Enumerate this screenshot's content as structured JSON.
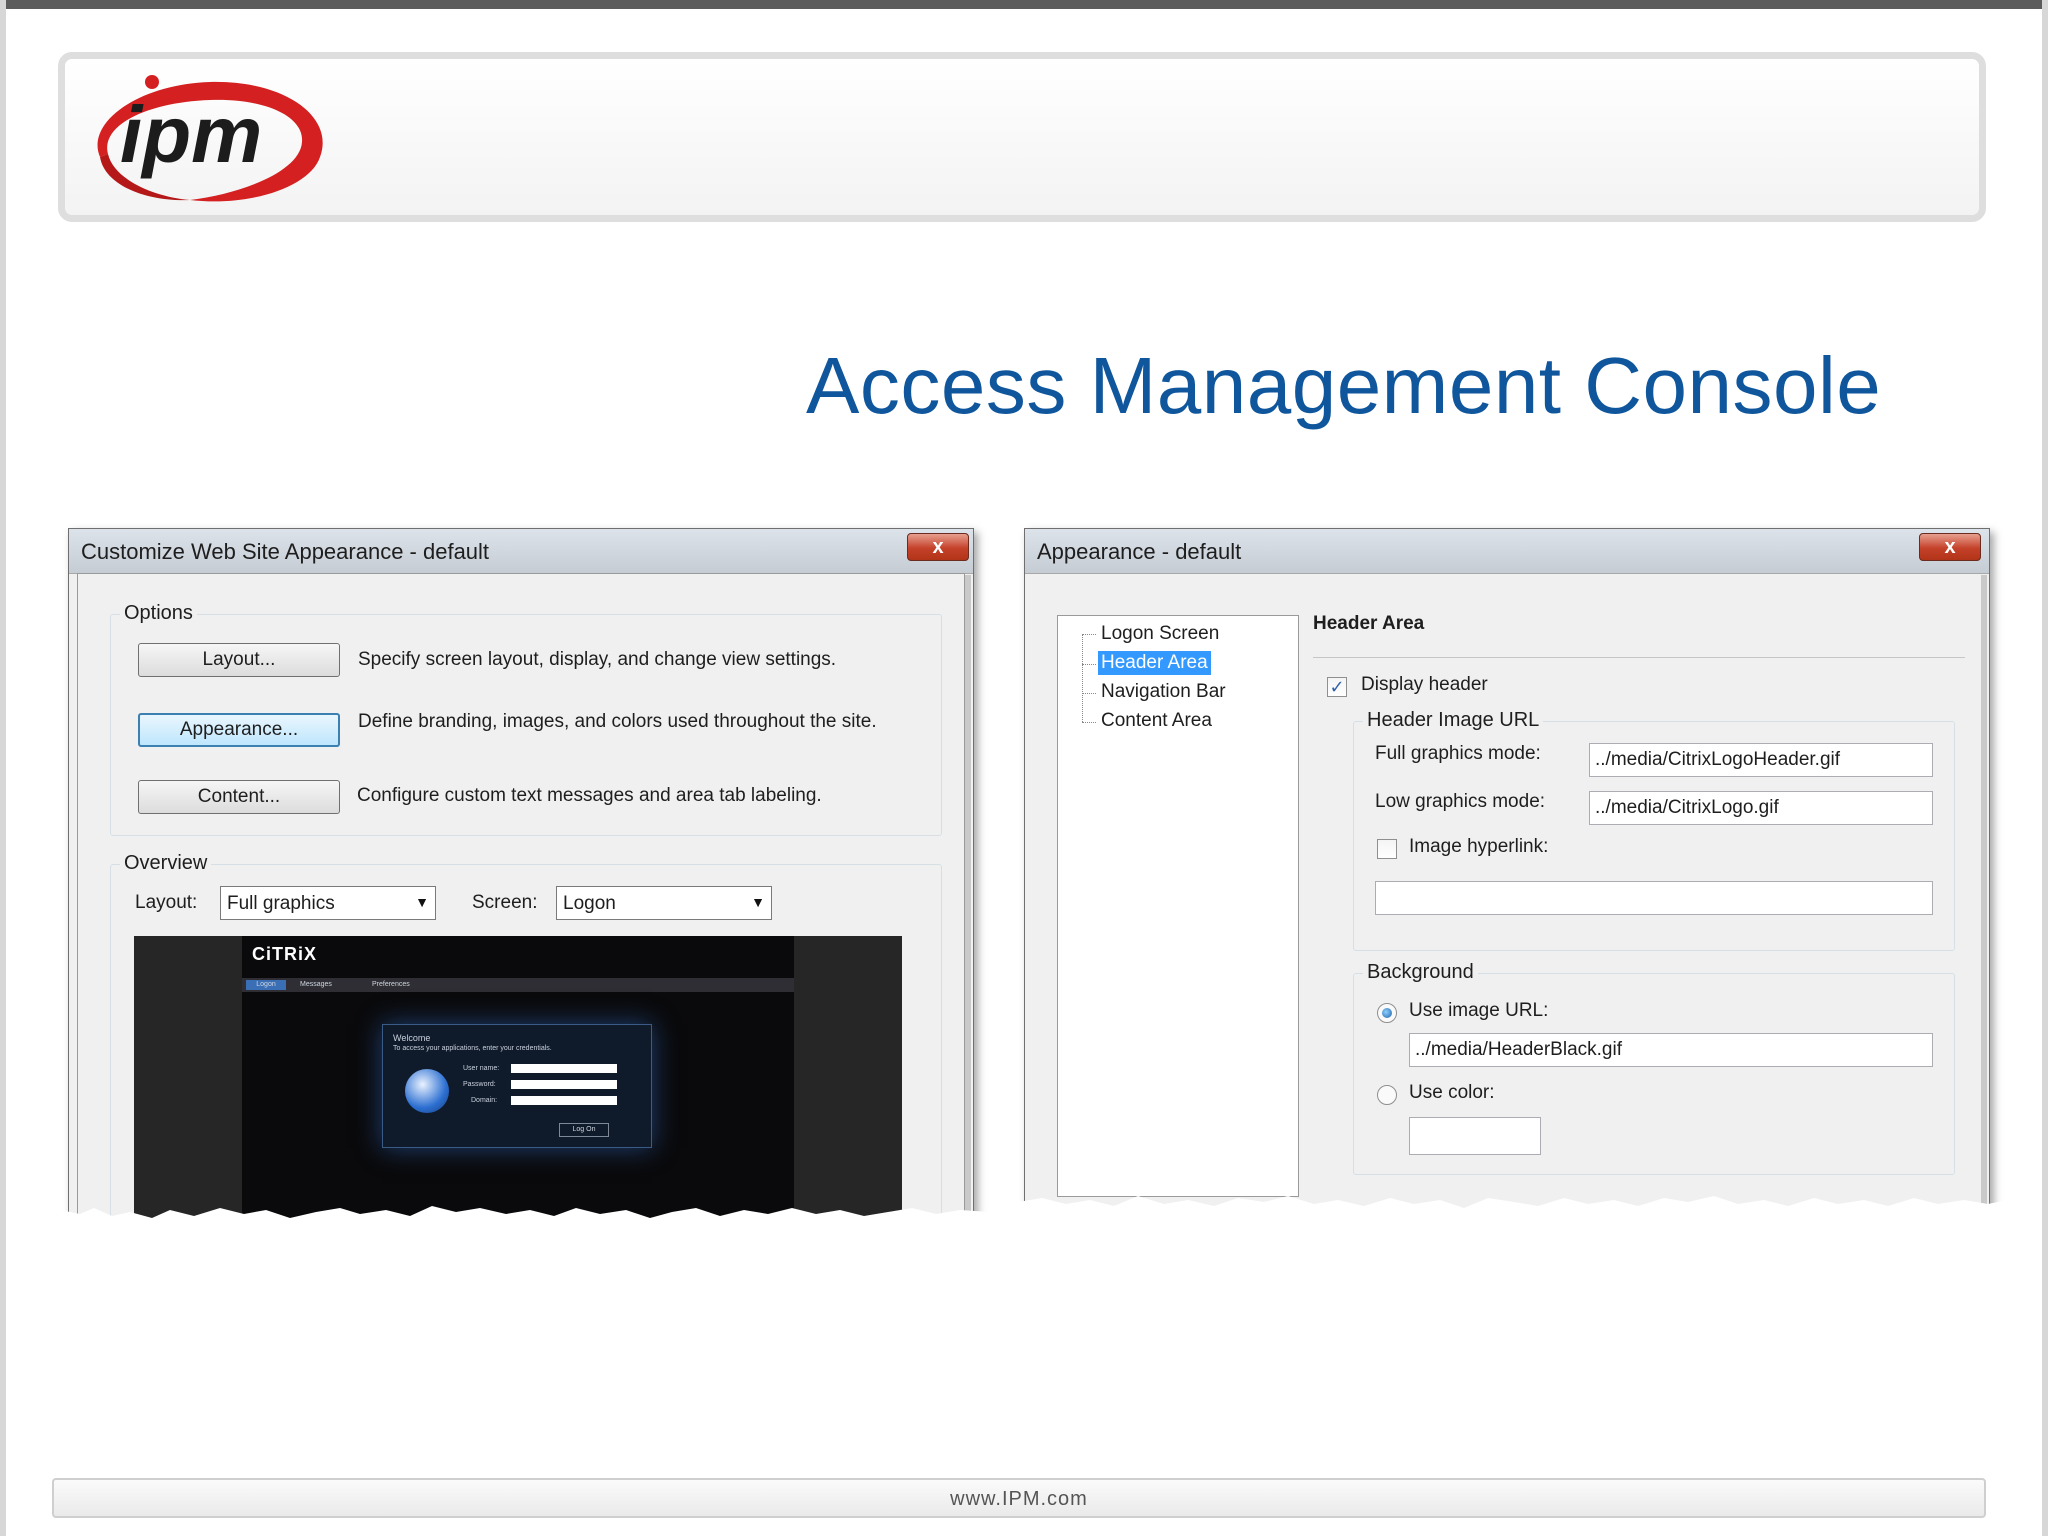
{
  "slide": {
    "logo_text": "ipm",
    "title": "Access Management Console",
    "footer_url": "www.IPM.com"
  },
  "colors": {
    "title": "#0f569c",
    "logo_red": "#d42020",
    "selection": "#3399ff"
  },
  "customize_dialog": {
    "title": "Customize Web Site Appearance - default",
    "close_glyph": "x",
    "options_group": "Options",
    "buttons": [
      {
        "label": "Layout...",
        "description": "Specify screen layout, display, and change view settings."
      },
      {
        "label": "Appearance...",
        "description": "Define branding, images, and colors used throughout the site."
      },
      {
        "label": "Content...",
        "description": "Configure custom text messages and area tab labeling."
      }
    ],
    "overview_group": "Overview",
    "layout_label": "Layout:",
    "layout_value": "Full graphics",
    "screen_label": "Screen:",
    "screen_value": "Logon",
    "preview": {
      "brand": "CiTRiX",
      "tabs": [
        "Logon",
        "Messages",
        "Preferences"
      ],
      "welcome": "Welcome",
      "instruction": "To access your applications, enter your credentials.",
      "fields": [
        "User name:",
        "Password:",
        "Domain:"
      ],
      "login_button": "Log On"
    }
  },
  "appearance_dialog": {
    "title": "Appearance - default",
    "close_glyph": "x",
    "tree": [
      "Logon Screen",
      "Header Area",
      "Navigation Bar",
      "Content Area"
    ],
    "selected_tree_item": "Header Area",
    "section_title": "Header Area",
    "display_header_label": "Display header",
    "display_header_checked": true,
    "header_image_group": "Header Image URL",
    "full_graphics_label": "Full graphics mode:",
    "full_graphics_value": "../media/CitrixLogoHeader.gif",
    "low_graphics_label": "Low graphics mode:",
    "low_graphics_value": "../media/CitrixLogo.gif",
    "image_hyperlink_label": "Image hyperlink:",
    "image_hyperlink_checked": false,
    "image_hyperlink_value": "",
    "background_group": "Background",
    "use_image_url_label": "Use image URL:",
    "use_image_url_value": "../media/HeaderBlack.gif",
    "use_color_label": "Use color:",
    "selected_background_option": "Use image URL:"
  }
}
